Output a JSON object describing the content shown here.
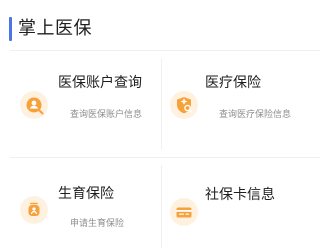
{
  "page": {
    "title": "掌上医保"
  },
  "colors": {
    "accent": "#4a76e8",
    "icon_bg": "#fff1df",
    "icon_fg": "#f7a13a"
  },
  "tiles": [
    {
      "title": "医保账户查询",
      "subtitle": "查询医保账户信息",
      "icon": "user-search-icon"
    },
    {
      "title": "医疗保险",
      "subtitle": "查询医疗保险信息",
      "icon": "shield-search-icon"
    },
    {
      "title": "生育保险",
      "subtitle": "申请生育保险",
      "icon": "maternity-icon"
    },
    {
      "title": "社保卡信息",
      "subtitle": "",
      "icon": "card-icon"
    }
  ]
}
